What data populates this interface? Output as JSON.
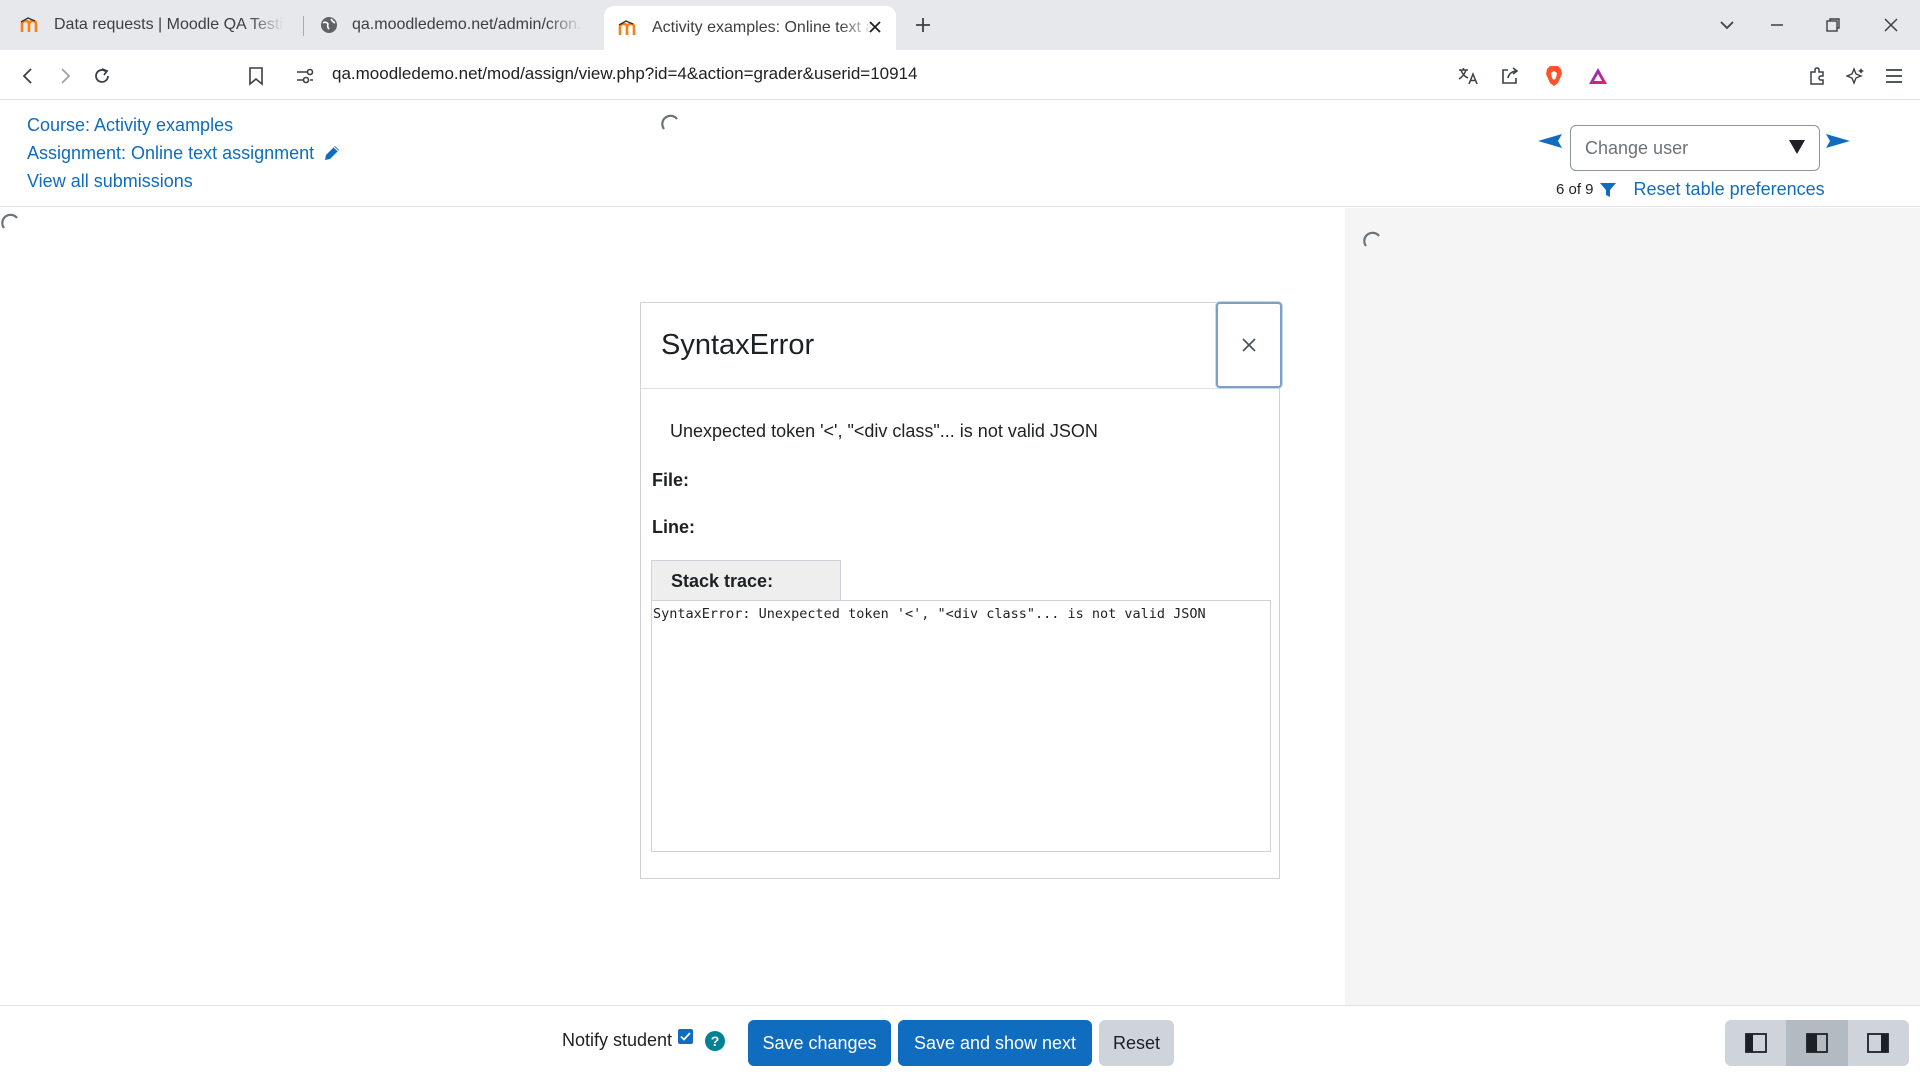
{
  "browser": {
    "tabs": [
      {
        "title": "Data requests | Moodle QA Testing"
      },
      {
        "title": "qa.moodledemo.net/admin/cron.php"
      },
      {
        "title": "Activity examples: Online text assignment"
      }
    ],
    "url": "qa.moodledemo.net/mod/assign/view.php?id=4&action=grader&userid=10914"
  },
  "header": {
    "course_link": "Course: Activity examples",
    "assignment_link": "Assignment: Online text assignment",
    "view_all_link": "View all submissions",
    "change_user_placeholder": "Change user",
    "user_count": "6 of 9",
    "reset_prefs_link": "Reset table preferences"
  },
  "modal": {
    "title": "SyntaxError",
    "message": "Unexpected token '<', \"<div class\"... is not valid JSON",
    "file_label": "File:",
    "line_label": "Line:",
    "stack_label": "Stack trace:",
    "stack_trace": "SyntaxError: Unexpected token '<', \"<div class\"... is not valid JSON"
  },
  "footer": {
    "notify_label": "Notify student",
    "notify_checked": true,
    "save_label": "Save changes",
    "save_next_label": "Save and show next",
    "reset_label": "Reset"
  },
  "colors": {
    "link": "#0f6cbf",
    "primary_button": "#0f6cbf",
    "help_icon": "#008196",
    "brave_shield": "#fb542b"
  },
  "icons": {
    "moodle_favicon": "moodle-icon",
    "globe_favicon": "globe-icon",
    "brave": "brave-shield-icon",
    "rewards": "triangle-icon"
  }
}
